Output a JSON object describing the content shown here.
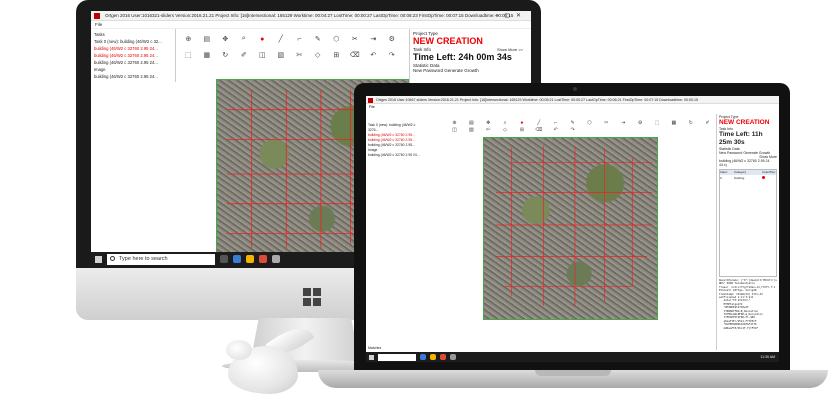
{
  "imac": {
    "title_bar": "Ortgen 2016   User:1016321-sliders   Version:2016.21.21   Project Info: [16]Intersectional: 165129   Worktime: 00:04:27   LostTime: 00:00:27   LastOpTime: 00:08:23   FirstOpTime: 00:07:15   Downloadtime: 00:00:15",
    "menu_label": "File",
    "tasks_label": "Tasks",
    "layers": [
      {
        "label": "Task 0 (new): building (46/W2 c 32...",
        "red": false
      },
      {
        "label": "building (46/W2 c 32760 2.95 24...",
        "red": true
      },
      {
        "label": "building (46/W2 c 32760 2.95 24...",
        "red": true
      },
      {
        "label": "building (46/W2 c 32760 2.95 24...",
        "red": false
      },
      {
        "label": "Image",
        "red": false
      },
      {
        "label": "building (46/W2 c 32760 2.95 24...",
        "red": false
      }
    ],
    "project_type_label": "Project Type",
    "project_type_value": "NEW CREATION",
    "task_info_label": "Task Info",
    "show_more": "Show More >>",
    "time_left": "Time Left: 24h 00m 34s",
    "statistic_label": "Statistic Data",
    "statistic_value": "New Password Generate Growth",
    "taskbar_search": "Type here to search"
  },
  "macbook": {
    "title_bar": "Ortgen 2016   User:10467 sliders   Version:2016.21.21   Project Info: [16]Intersectional: 165129   Worktime: 00:05:21   LostTime: 00:00:27   LastOpTime: 00:06:21   FirstOpTime: 00:07:15   Downloadtime: 00:00:15",
    "menu_label": "File",
    "layers": [
      {
        "label": "Task 0 (new): building (46/W2 c 3276...",
        "red": false
      },
      {
        "label": "building (46/W2 c 32760 2.95...",
        "red": true
      },
      {
        "label": "building (46/W2 c 32760 2.95...",
        "red": true
      },
      {
        "label": "building (46/W2 c 32760 2.95...",
        "red": false
      },
      {
        "label": "Image",
        "red": false
      },
      {
        "label": "building (46/W2 c 32760 2.95 24...",
        "red": false
      }
    ],
    "project_type_label": "Project Type",
    "project_type_value": "NEW CREATION",
    "task_info_label": "Task Info",
    "time_left": "Time Left: 11h 25m 30s",
    "statistic_label": "Statistic Data",
    "statistic_value": "New Password Generate Growth",
    "show_more": "Show More",
    "building_attr": "building (46/W2 c 32760 2.95 24 44.x)",
    "table_headers": [
      "Index",
      "Category",
      "Color/Pen"
    ],
    "table_rows": [
      {
        "index": "0",
        "category": "building",
        "color": "#ff0000"
      }
    ],
    "status": "Matches",
    "log_text": "ResultParams: {\"0\":[deaqlit(TBlUtrr)sutNis\nNDS\" 0000 Telementiatio\nflaser  noticiftg/t10eo~1d,f7Oft.f:1\nEtimoatr 03ftga. Swrig28\nTimeStamp: 101&9(04) Stfo~43\nsetFinished 1:11:3:$11\n   data\\\"f5:$f$fdr\\\"\n   MTHPTalgs$f2\n   *#HIDDE$t4f0dwJF\n   tTRNMATFRO~B_Decoation\n   tOTMALARLNFRO~$_Decoation\n   tTFEAEFOT$FRO~Tl.$R0\n   qDeaFtEr/U5kJ.FftP5CF\n   *#vEEKHARRS1OIE$F4tf0\n   m#DeaFtE/DSiIF.FjtF5CF",
    "tray_time": "11:30 AM"
  }
}
